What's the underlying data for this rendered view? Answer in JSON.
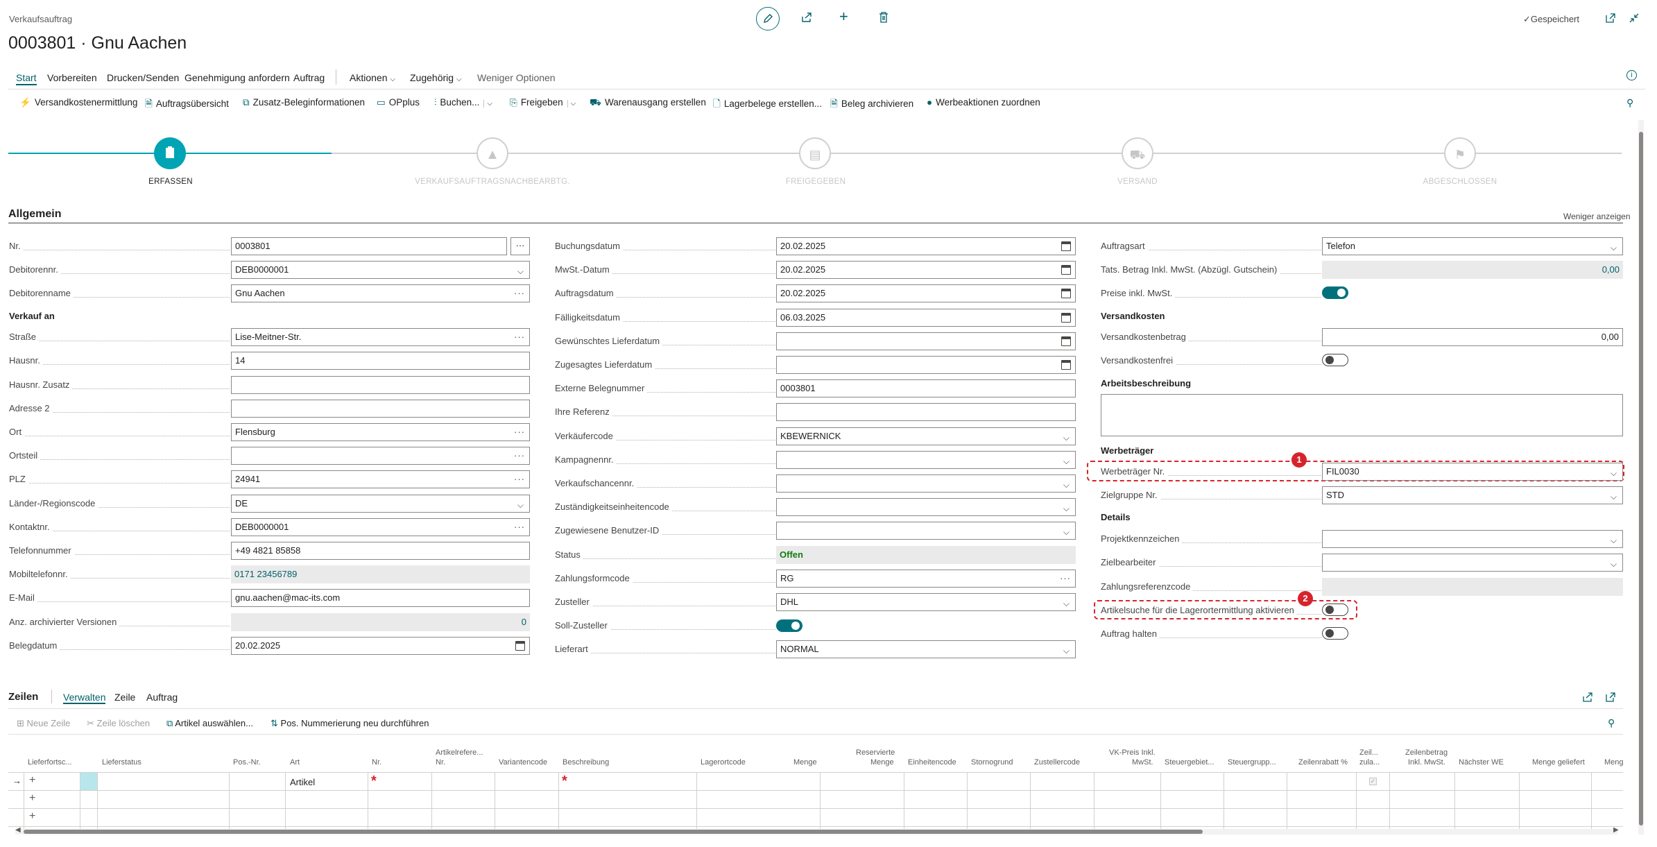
{
  "window": {
    "breadcrumb": "Verkaufsauftrag",
    "title": "0003801 · Gnu Aachen",
    "saved": "Gespeichert"
  },
  "icons": {
    "edit": "pencil-icon",
    "share": "share-icon",
    "new": "plus-icon",
    "delete": "trash-icon",
    "popout": "open-in-new-window-icon",
    "collapse": "collapse-icon",
    "info": "info-icon",
    "pin": "pin-icon"
  },
  "colors": {
    "accent": "#00717c",
    "badge": "#d6242c"
  },
  "tabs": [
    {
      "label": "Start"
    },
    {
      "label": "Vorbereiten"
    },
    {
      "label": "Drucken/Senden"
    },
    {
      "label": "Genehmigung anfordern"
    },
    {
      "label": "Auftrag"
    },
    {
      "label": "Aktionen"
    },
    {
      "label": "Zugehörig"
    },
    {
      "label": "Weniger Optionen"
    }
  ],
  "actions": [
    {
      "label": "Versandkostenermittlung"
    },
    {
      "label": "Auftragsübersicht"
    },
    {
      "label": "Zusatz-Beleginformationen"
    },
    {
      "label": "OPplus"
    },
    {
      "label": "Buchen..."
    },
    {
      "label": "Freigeben"
    },
    {
      "label": "Warenausgang erstellen"
    },
    {
      "label": "Lagerbelege erstellen..."
    },
    {
      "label": "Beleg archivieren"
    },
    {
      "label": "Werbeaktionen zuordnen"
    }
  ],
  "steps": [
    {
      "label": "ERFASSEN"
    },
    {
      "label": "VERKAUFSAUFTRAGSNACHBEARBTG."
    },
    {
      "label": "FREIGEGEBEN"
    },
    {
      "label": "VERSAND"
    },
    {
      "label": "ABGESCHLOSSEN"
    }
  ],
  "general": {
    "title": "Allgemein",
    "show_less": "Weniger anzeigen",
    "col1": {
      "nr": {
        "label": "Nr.",
        "value": "0003801"
      },
      "debitorennr": {
        "label": "Debitorennr.",
        "value": "DEB0000001"
      },
      "debitorenname": {
        "label": "Debitorenname",
        "value": "Gnu Aachen"
      },
      "verkauf_an": "Verkauf an",
      "strasse": {
        "label": "Straße",
        "value": "Lise-Meitner-Str."
      },
      "hausnr": {
        "label": "Hausnr.",
        "value": "14"
      },
      "hausnr_zusatz": {
        "label": "Hausnr. Zusatz",
        "value": ""
      },
      "adresse2": {
        "label": "Adresse 2",
        "value": ""
      },
      "ort": {
        "label": "Ort",
        "value": "Flensburg"
      },
      "ortsteil": {
        "label": "Ortsteil",
        "value": ""
      },
      "plz": {
        "label": "PLZ",
        "value": "24941"
      },
      "land": {
        "label": "Länder-/Regionscode",
        "value": "DE"
      },
      "kontaktnr": {
        "label": "Kontaktnr.",
        "value": "DEB0000001"
      },
      "telefon": {
        "label": "Telefonnummer",
        "value": "+49 4821 85858"
      },
      "mobil": {
        "label": "Mobiltelefonnr.",
        "value": "0171 23456789"
      },
      "email": {
        "label": "E-Mail",
        "value": "gnu.aachen@mac-its.com"
      },
      "archiv": {
        "label": "Anz. archivierter Versionen",
        "value": "0"
      },
      "belegdatum": {
        "label": "Belegdatum",
        "value": "20.02.2025"
      }
    },
    "col2": {
      "buchungsdatum": {
        "label": "Buchungsdatum",
        "value": "20.02.2025"
      },
      "mwst_datum": {
        "label": "MwSt.-Datum",
        "value": "20.02.2025"
      },
      "auftragsdatum": {
        "label": "Auftragsdatum",
        "value": "20.02.2025"
      },
      "faelligkeitsdatum": {
        "label": "Fälligkeitsdatum",
        "value": "06.03.2025"
      },
      "gew_lieferdatum": {
        "label": "Gewünschtes Lieferdatum",
        "value": ""
      },
      "zug_lieferdatum": {
        "label": "Zugesagtes Lieferdatum",
        "value": ""
      },
      "ext_beleg": {
        "label": "Externe Belegnummer",
        "value": "0003801"
      },
      "ihre_ref": {
        "label": "Ihre Referenz",
        "value": ""
      },
      "verkaeufer": {
        "label": "Verkäufercode",
        "value": "KBEWERNICK"
      },
      "kampagne": {
        "label": "Kampagnennr.",
        "value": ""
      },
      "verkaufschance": {
        "label": "Verkaufschancennr.",
        "value": ""
      },
      "zustaendigkeit": {
        "label": "Zuständigkeitseinheitencode",
        "value": ""
      },
      "benutzer": {
        "label": "Zugewiesene Benutzer-ID",
        "value": ""
      },
      "status": {
        "label": "Status",
        "value": "Offen"
      },
      "zahlungsform": {
        "label": "Zahlungsformcode",
        "value": "RG"
      },
      "zusteller": {
        "label": "Zusteller",
        "value": "DHL"
      },
      "soll_zusteller": {
        "label": "Soll-Zusteller"
      },
      "lieferart": {
        "label": "Lieferart",
        "value": "NORMAL"
      }
    },
    "col3": {
      "auftragsart": {
        "label": "Auftragsart",
        "value": "Telefon"
      },
      "tats_betrag": {
        "label": "Tats. Betrag Inkl. MwSt. (Abzügl. Gutschein)",
        "value": "0,00"
      },
      "preise_inkl": {
        "label": "Preise inkl. MwSt."
      },
      "versandkosten": "Versandkosten",
      "versandkostenbetrag": {
        "label": "Versandkostenbetrag",
        "value": "0,00"
      },
      "versandkostenfrei": {
        "label": "Versandkostenfrei"
      },
      "arbeitsbeschreibung": "Arbeitsbeschreibung",
      "werbetraeger": "Werbeträger",
      "werbetraeger_nr": {
        "label": "Werbeträger Nr.",
        "value": "FIL0030"
      },
      "zielgruppe": {
        "label": "Zielgruppe Nr.",
        "value": "STD"
      },
      "details": "Details",
      "projekt": {
        "label": "Projektkennzeichen",
        "value": ""
      },
      "zielbearbeiter": {
        "label": "Zielbearbeiter",
        "value": ""
      },
      "zahlungsreferenz": {
        "label": "Zahlungsreferenzcode",
        "value": ""
      },
      "artikelsuche": {
        "label": "Artikelsuche für die Lagerortermittlung aktivieren"
      },
      "auftrag_halten": {
        "label": "Auftrag halten"
      }
    },
    "badges": [
      "1",
      "2"
    ]
  },
  "lines": {
    "title": "Zeilen",
    "tabs": [
      {
        "label": "Verwalten"
      },
      {
        "label": "Zeile"
      },
      {
        "label": "Auftrag"
      }
    ],
    "actions": [
      {
        "label": "Neue Zeile"
      },
      {
        "label": "Zeile löschen"
      },
      {
        "label": "Artikel auswählen..."
      },
      {
        "label": "Pos. Nummerierung neu durchführen"
      }
    ],
    "columns": [
      {
        "l1": "",
        "l2": "Lieferfortsc..."
      },
      {
        "l1": "",
        "l2": "Lieferstatus"
      },
      {
        "l1": "",
        "l2": "Pos.-Nr."
      },
      {
        "l1": "",
        "l2": "Art"
      },
      {
        "l1": "",
        "l2": "Nr."
      },
      {
        "l1": "Artikelrefere...",
        "l2": "Nr."
      },
      {
        "l1": "",
        "l2": "Variantencode"
      },
      {
        "l1": "",
        "l2": "Beschreibung"
      },
      {
        "l1": "",
        "l2": "Lagerortcode"
      },
      {
        "l1": "",
        "l2": "Menge"
      },
      {
        "l1": "Reservierte",
        "l2": "Menge"
      },
      {
        "l1": "",
        "l2": "Einheitencode"
      },
      {
        "l1": "",
        "l2": "Stornogrund"
      },
      {
        "l1": "",
        "l2": "Zustellercode"
      },
      {
        "l1": "VK-Preis Inkl.",
        "l2": "MwSt."
      },
      {
        "l1": "",
        "l2": "Steuergebiet..."
      },
      {
        "l1": "",
        "l2": "Steuergrupp..."
      },
      {
        "l1": "",
        "l2": "Zeilenrabatt %"
      },
      {
        "l1": "Zeil...",
        "l2": "zula..."
      },
      {
        "l1": "Zeilenbetrag",
        "l2": "Inkl. MwSt."
      },
      {
        "l1": "",
        "l2": "Nächster WE"
      },
      {
        "l1": "",
        "l2": "Menge geliefert"
      },
      {
        "l1": "",
        "l2": "Meng"
      }
    ],
    "row1": {
      "art": "Artikel",
      "required": "*"
    }
  }
}
